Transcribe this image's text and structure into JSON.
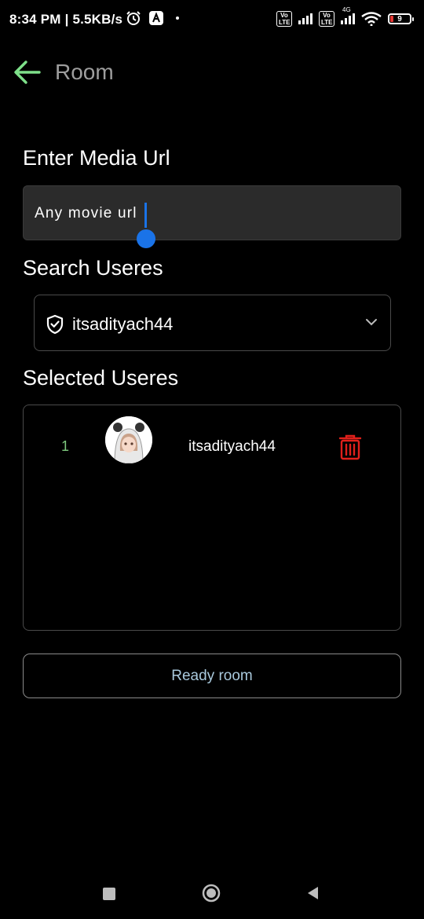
{
  "status_bar": {
    "time_speed": "8:34 PM | 5.5KB/s",
    "volte_1": "Vo LTE",
    "volte_2": "Vo LTE",
    "network": "4G",
    "battery": "9",
    "battery_color": "#e53935"
  },
  "app_bar": {
    "title": "Room",
    "back_icon": "arrow-left-icon",
    "accent": "#7ee08a"
  },
  "media": {
    "label": "Enter Media Url",
    "value": "Any movie url",
    "cursor_color": "#1a73e8"
  },
  "search": {
    "label": "Search Useres",
    "selected_value": "itsadityach44",
    "icon": "shield-check-icon",
    "dropdown_icon": "chevron-down-icon"
  },
  "selected_users": {
    "label": "Selected Useres",
    "rows": [
      {
        "index": "1",
        "username": "itsadityach44",
        "avatar": "avatar-image",
        "delete_icon": "trash-icon"
      }
    ],
    "delete_color": "#e0201b"
  },
  "actions": {
    "ready_label": "Ready room",
    "ready_color": "#a9c9dd"
  },
  "nav": {
    "recents_icon": "square-icon",
    "home_icon": "circle-icon",
    "back_icon": "triangle-back-icon"
  }
}
